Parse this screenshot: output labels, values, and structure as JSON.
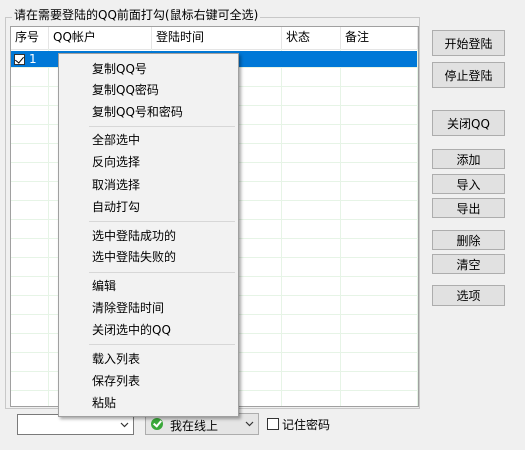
{
  "window": {
    "group_title": "请在需要登陆的QQ前面打勾(鼠标右键可全选)"
  },
  "list": {
    "columns": [
      "序号",
      "QQ帐户",
      "登陆时间",
      "状态",
      "备注"
    ],
    "rows": [
      {
        "checked": true,
        "index": "1",
        "account": "",
        "login_time": "",
        "status": "",
        "note": ""
      }
    ]
  },
  "buttons": {
    "start_login": "开始登陆",
    "stop_login": "停止登陆",
    "close_qq": "关闭QQ",
    "add": "添加",
    "import": "导入",
    "export": "导出",
    "delete": "删除",
    "clear": "清空",
    "options": "选项"
  },
  "context_menu": {
    "items": [
      "复制QQ号",
      "复制QQ密码",
      "复制QQ号和密码",
      "全部选中",
      "反向选择",
      "取消选择",
      "自动打勾",
      "选中登陆成功的",
      "选中登陆失败的",
      "编辑",
      "清除登陆时间",
      "关闭选中的QQ",
      "载入列表",
      "保存列表",
      "粘贴"
    ]
  },
  "bottom": {
    "account_combo_value": "",
    "status_value": "我在线上",
    "remember_password_label": "记住密码",
    "remember_password_checked": false
  },
  "colors": {
    "selection": "#0078d7",
    "status_online": "#3aa83a"
  }
}
